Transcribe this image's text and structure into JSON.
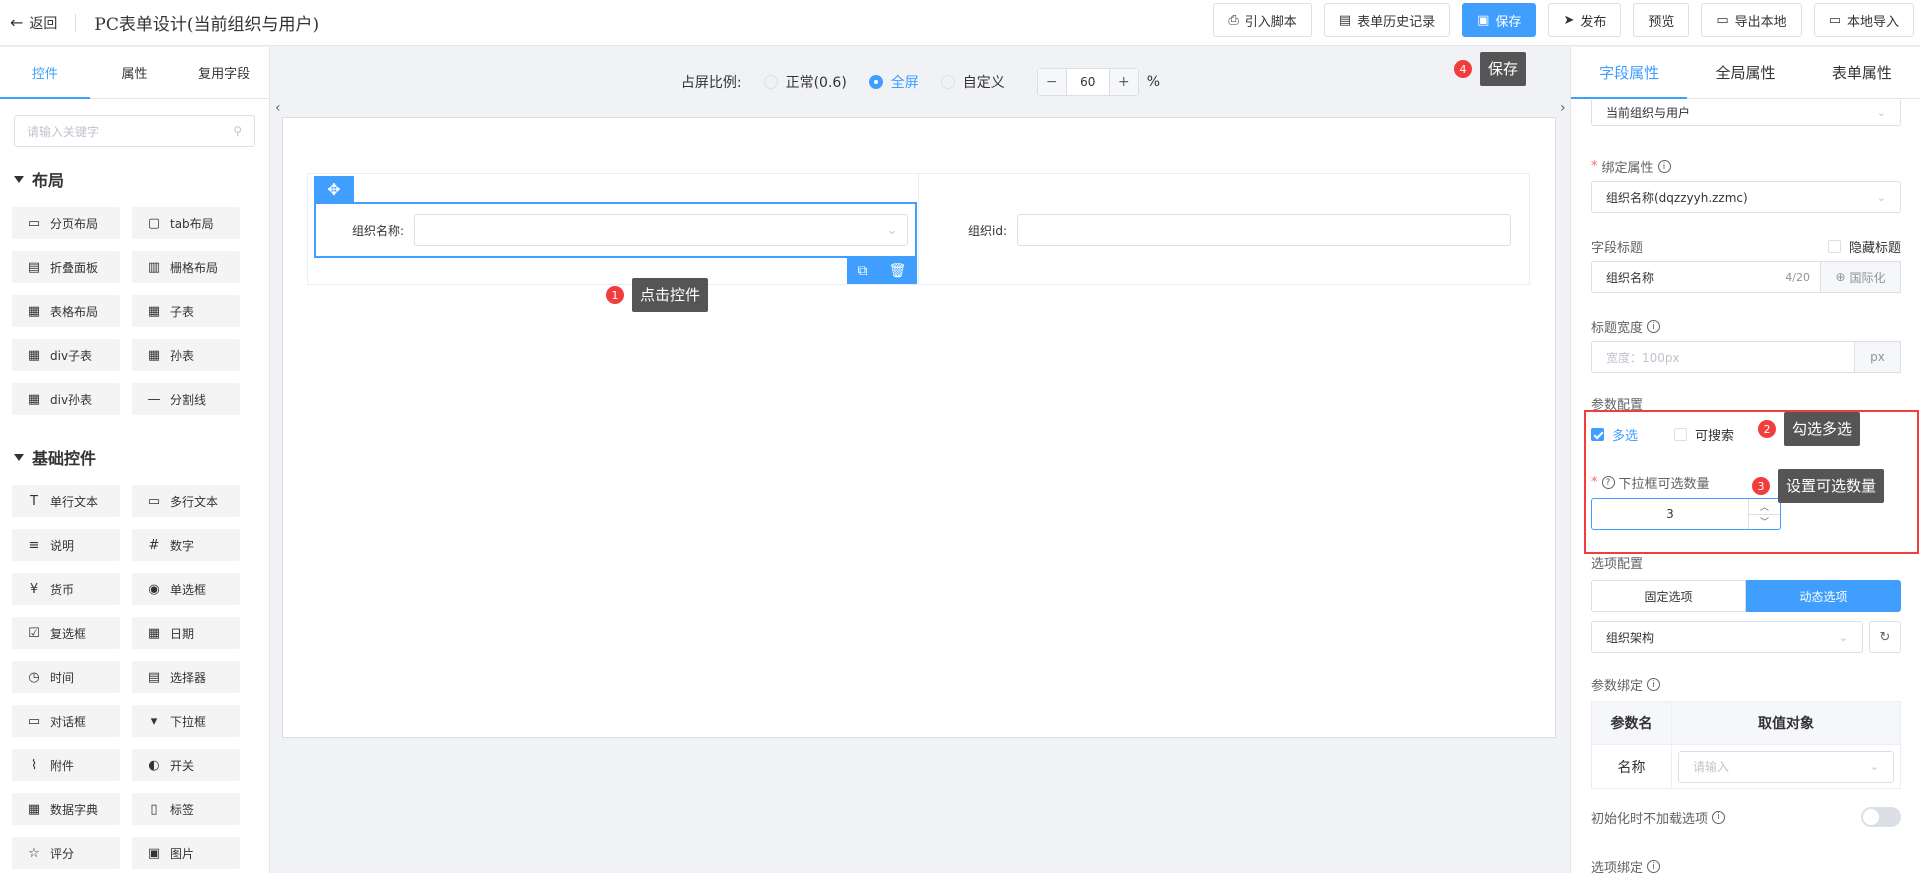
{
  "header": {
    "back_label": "返回",
    "title": "PC表单设计(当前组织与用户)",
    "actions": [
      {
        "name": "import-script-button",
        "icon": "import-icon",
        "label": "引入脚本",
        "primary": false
      },
      {
        "name": "form-history-button",
        "icon": "history-icon",
        "label": "表单历史记录",
        "primary": false
      },
      {
        "name": "save-button",
        "icon": "save-icon",
        "label": "保存",
        "primary": true
      },
      {
        "name": "publish-button",
        "icon": "publish-icon",
        "label": "发布",
        "primary": false
      },
      {
        "name": "preview-button",
        "icon": "",
        "label": "预览",
        "primary": false
      },
      {
        "name": "export-local-button",
        "icon": "folder-icon",
        "label": "导出本地",
        "primary": false
      },
      {
        "name": "import-local-button",
        "icon": "folder-icon",
        "label": "本地导入",
        "primary": false
      }
    ]
  },
  "left": {
    "tabs": [
      "控件",
      "属性",
      "复用字段"
    ],
    "search_placeholder": "请输入关键字",
    "sections": [
      {
        "title": "布局",
        "items": [
          {
            "label": "分页布局",
            "icon": "▭"
          },
          {
            "label": "tab布局",
            "icon": "▢"
          },
          {
            "label": "折叠面板",
            "icon": "▤"
          },
          {
            "label": "栅格布局",
            "icon": "▥"
          },
          {
            "label": "表格布局",
            "icon": "▦"
          },
          {
            "label": "子表",
            "icon": "▦"
          },
          {
            "label": "div子表",
            "icon": "▦"
          },
          {
            "label": "孙表",
            "icon": "▦"
          },
          {
            "label": "div孙表",
            "icon": "▦"
          },
          {
            "label": "分割线",
            "icon": "—"
          }
        ]
      },
      {
        "title": "基础控件",
        "items": [
          {
            "label": "单行文本",
            "icon": "T"
          },
          {
            "label": "多行文本",
            "icon": "▭"
          },
          {
            "label": "说明",
            "icon": "≡"
          },
          {
            "label": "数字",
            "icon": "#"
          },
          {
            "label": "货币",
            "icon": "¥"
          },
          {
            "label": "单选框",
            "icon": "◉"
          },
          {
            "label": "复选框",
            "icon": "☑"
          },
          {
            "label": "日期",
            "icon": "▦"
          },
          {
            "label": "时间",
            "icon": "◷"
          },
          {
            "label": "选择器",
            "icon": "▤"
          },
          {
            "label": "对话框",
            "icon": "▭"
          },
          {
            "label": "下拉框",
            "icon": "▾"
          },
          {
            "label": "附件",
            "icon": "⌇"
          },
          {
            "label": "开关",
            "icon": "◐"
          },
          {
            "label": "数据字典",
            "icon": "▦"
          },
          {
            "label": "标签",
            "icon": "▯"
          },
          {
            "label": "评分",
            "icon": "☆"
          },
          {
            "label": "图片",
            "icon": "▣"
          }
        ]
      }
    ]
  },
  "canvas_bar": {
    "ratio_label": "占屏比例:",
    "options": [
      {
        "label": "正常(0.6)",
        "selected": false
      },
      {
        "label": "全屏",
        "selected": true
      },
      {
        "label": "自定义",
        "selected": false
      }
    ],
    "minus": "−",
    "value": "60",
    "plus": "+",
    "unit": "%"
  },
  "canvas": {
    "field1_label": "组织名称:",
    "field2_label": "组织id:"
  },
  "callouts": {
    "c1_num": "1",
    "c1_text": "点击控件",
    "c2_num": "2",
    "c2_text": "勾选多选",
    "c3_num": "3",
    "c3_text": "设置可选数量",
    "c4_num": "4",
    "c4_text": "保存"
  },
  "right": {
    "tabs": [
      "字段属性",
      "全局属性",
      "表单属性"
    ],
    "top_select_value": "当前组织与用户",
    "bind_label": "绑定属性",
    "bind_value": "组织名称(dqzzyyh.zzmc)",
    "field_title_label": "字段标题",
    "hide_title_label": "隐藏标题",
    "field_title_value": "组织名称",
    "field_title_count": "4/20",
    "i18n_label": "国际化",
    "title_width_label": "标题宽度",
    "title_width_placeholder": "宽度：100px",
    "title_width_unit": "px",
    "param_config_label": "参数配置",
    "multi_label": "多选",
    "multi_checked": true,
    "searchable_label": "可搜索",
    "searchable_checked": false,
    "max_select_label": "下拉框可选数量",
    "max_select_value": "3",
    "option_config_label": "选项配置",
    "option_fixed": "固定选项",
    "option_dynamic": "动态选项",
    "org_select_value": "组织架构",
    "param_bind_label": "参数绑定",
    "table_headers": [
      "参数名",
      "取值对象"
    ],
    "table_row_name": "名称",
    "table_row_placeholder": "请输入",
    "init_no_load_label": "初始化时不加载选项",
    "option_bind_label": "选项绑定"
  }
}
